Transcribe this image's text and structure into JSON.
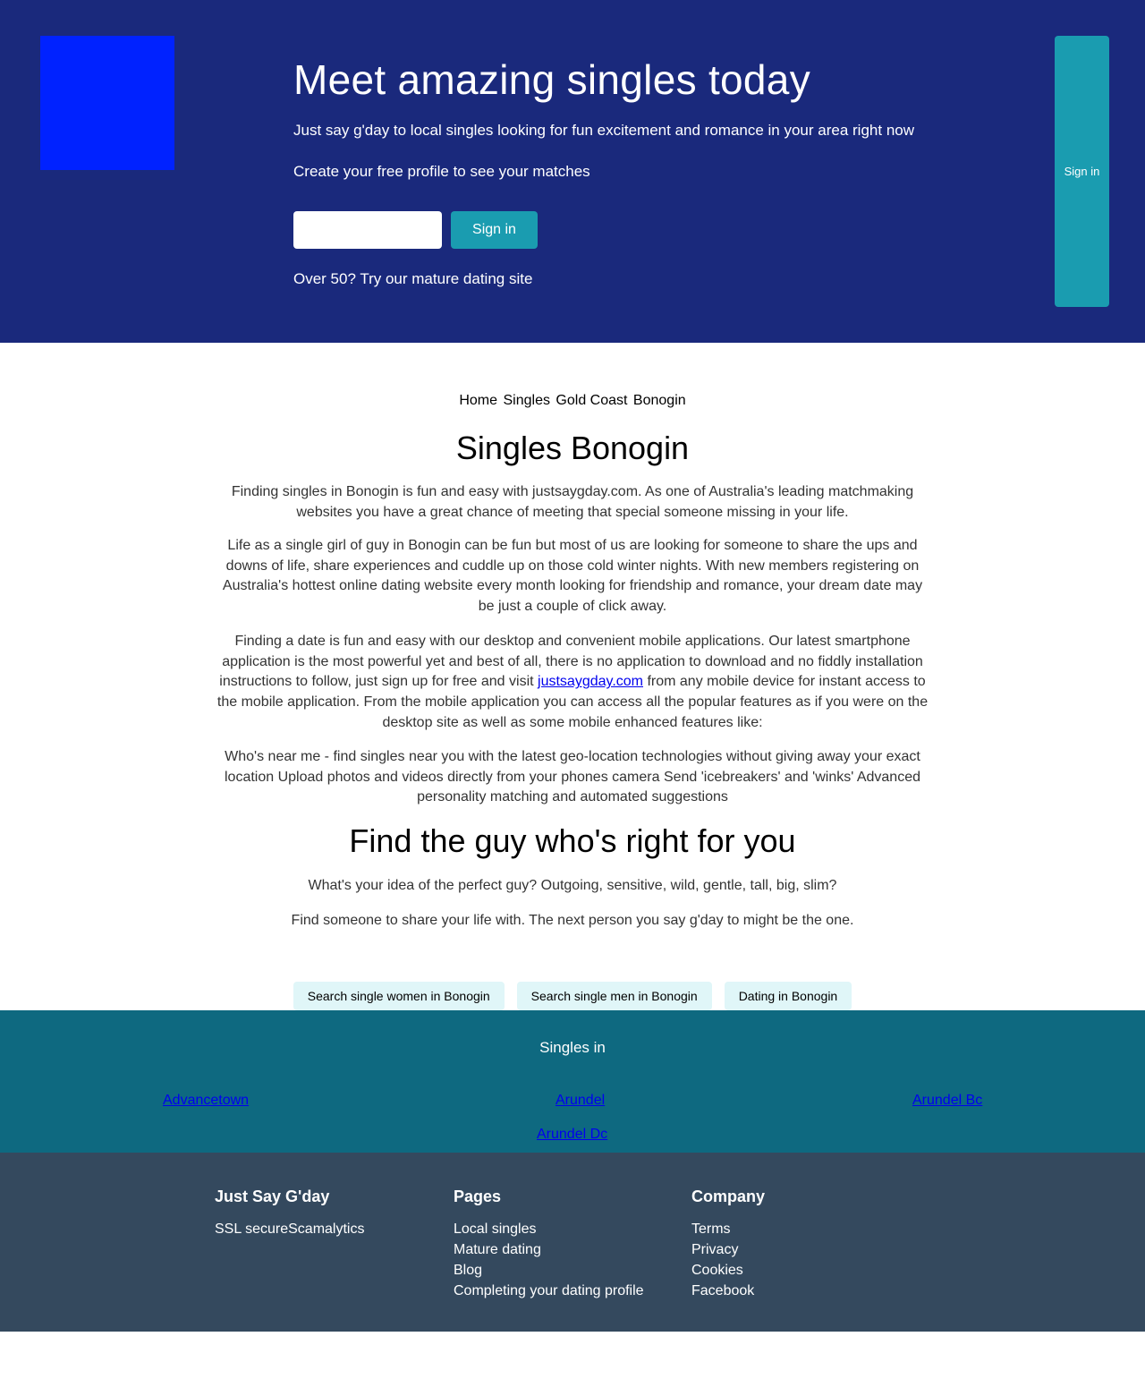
{
  "hero": {
    "title": "Meet amazing singles today",
    "subtitle": "Just say g'day to local singles looking for fun excitement and romance in your area right now",
    "subtitle2": "Create your free profile to see your matches",
    "input_value": "",
    "signin_label": "Sign in",
    "mature_text": "Over 50? Try our mature dating site",
    "side_signin_label": "Sign in"
  },
  "breadcrumb": [
    "Home",
    "Singles",
    "Gold Coast",
    "Bonogin"
  ],
  "main": {
    "title": "Singles Bonogin",
    "p1": "Finding singles in Bonogin is fun and easy with justsaygday.com. As one of Australia's leading matchmaking websites you have a great chance of meeting that special someone missing in your life.",
    "p2": "Life as a single girl of guy in Bonogin can be fun but most of us are looking for someone to share the ups and downs of life, share experiences and cuddle up on those cold winter nights. With new members registering on Australia's hottest online dating website every month looking for friendship and romance, your dream date may be just a couple of click away.",
    "p3_before": "Finding a date is fun and easy with our desktop and convenient mobile applications. Our latest smartphone application is the most powerful yet and best of all, there is no application to download and no fiddly installation instructions to follow, just sign up for free and visit ",
    "p3_link": "justsaygday.com",
    "p3_after": " from any mobile device for instant access to the mobile application. From the mobile application you can access all the popular features as if you were on the desktop site as well as some mobile enhanced features like:",
    "p4": "Who's near me - find singles near you with the latest geo-location technologies without giving away your exact location Upload photos and videos directly from your phones camera Send 'icebreakers' and 'winks' Advanced personality matching and automated suggestions",
    "title2": "Find the guy who's right for you",
    "p5": "What's your idea of the perfect guy? Outgoing, sensitive, wild, gentle, tall, big, slim?",
    "p6": "Find someone to share your life with. The next person you say g'day to might be the one."
  },
  "pills": [
    "Search single women in Bonogin",
    "Search single men in Bonogin",
    "Dating in Bonogin"
  ],
  "singles": {
    "title": "Singles in",
    "links": [
      "Advancetown",
      "Arundel",
      "Arundel Bc",
      "Arundel Dc"
    ]
  },
  "footer": {
    "brand": {
      "title": "Just Say G'day",
      "items": [
        "SSL secure",
        "Scamalytics"
      ]
    },
    "pages": {
      "title": "Pages",
      "items": [
        "Local singles",
        "Mature dating",
        "Blog",
        "Completing your dating profile"
      ]
    },
    "company": {
      "title": "Company",
      "items": [
        "Terms",
        "Privacy",
        "Cookies",
        "Facebook"
      ]
    }
  },
  "colors": {
    "hero_bg": "#1a297c",
    "logo": "#0022ff",
    "accent": "#1a9cb0",
    "band_bg": "#0e6980",
    "footer_bg": "#34495e",
    "pill_bg": "#e0f6f8"
  }
}
